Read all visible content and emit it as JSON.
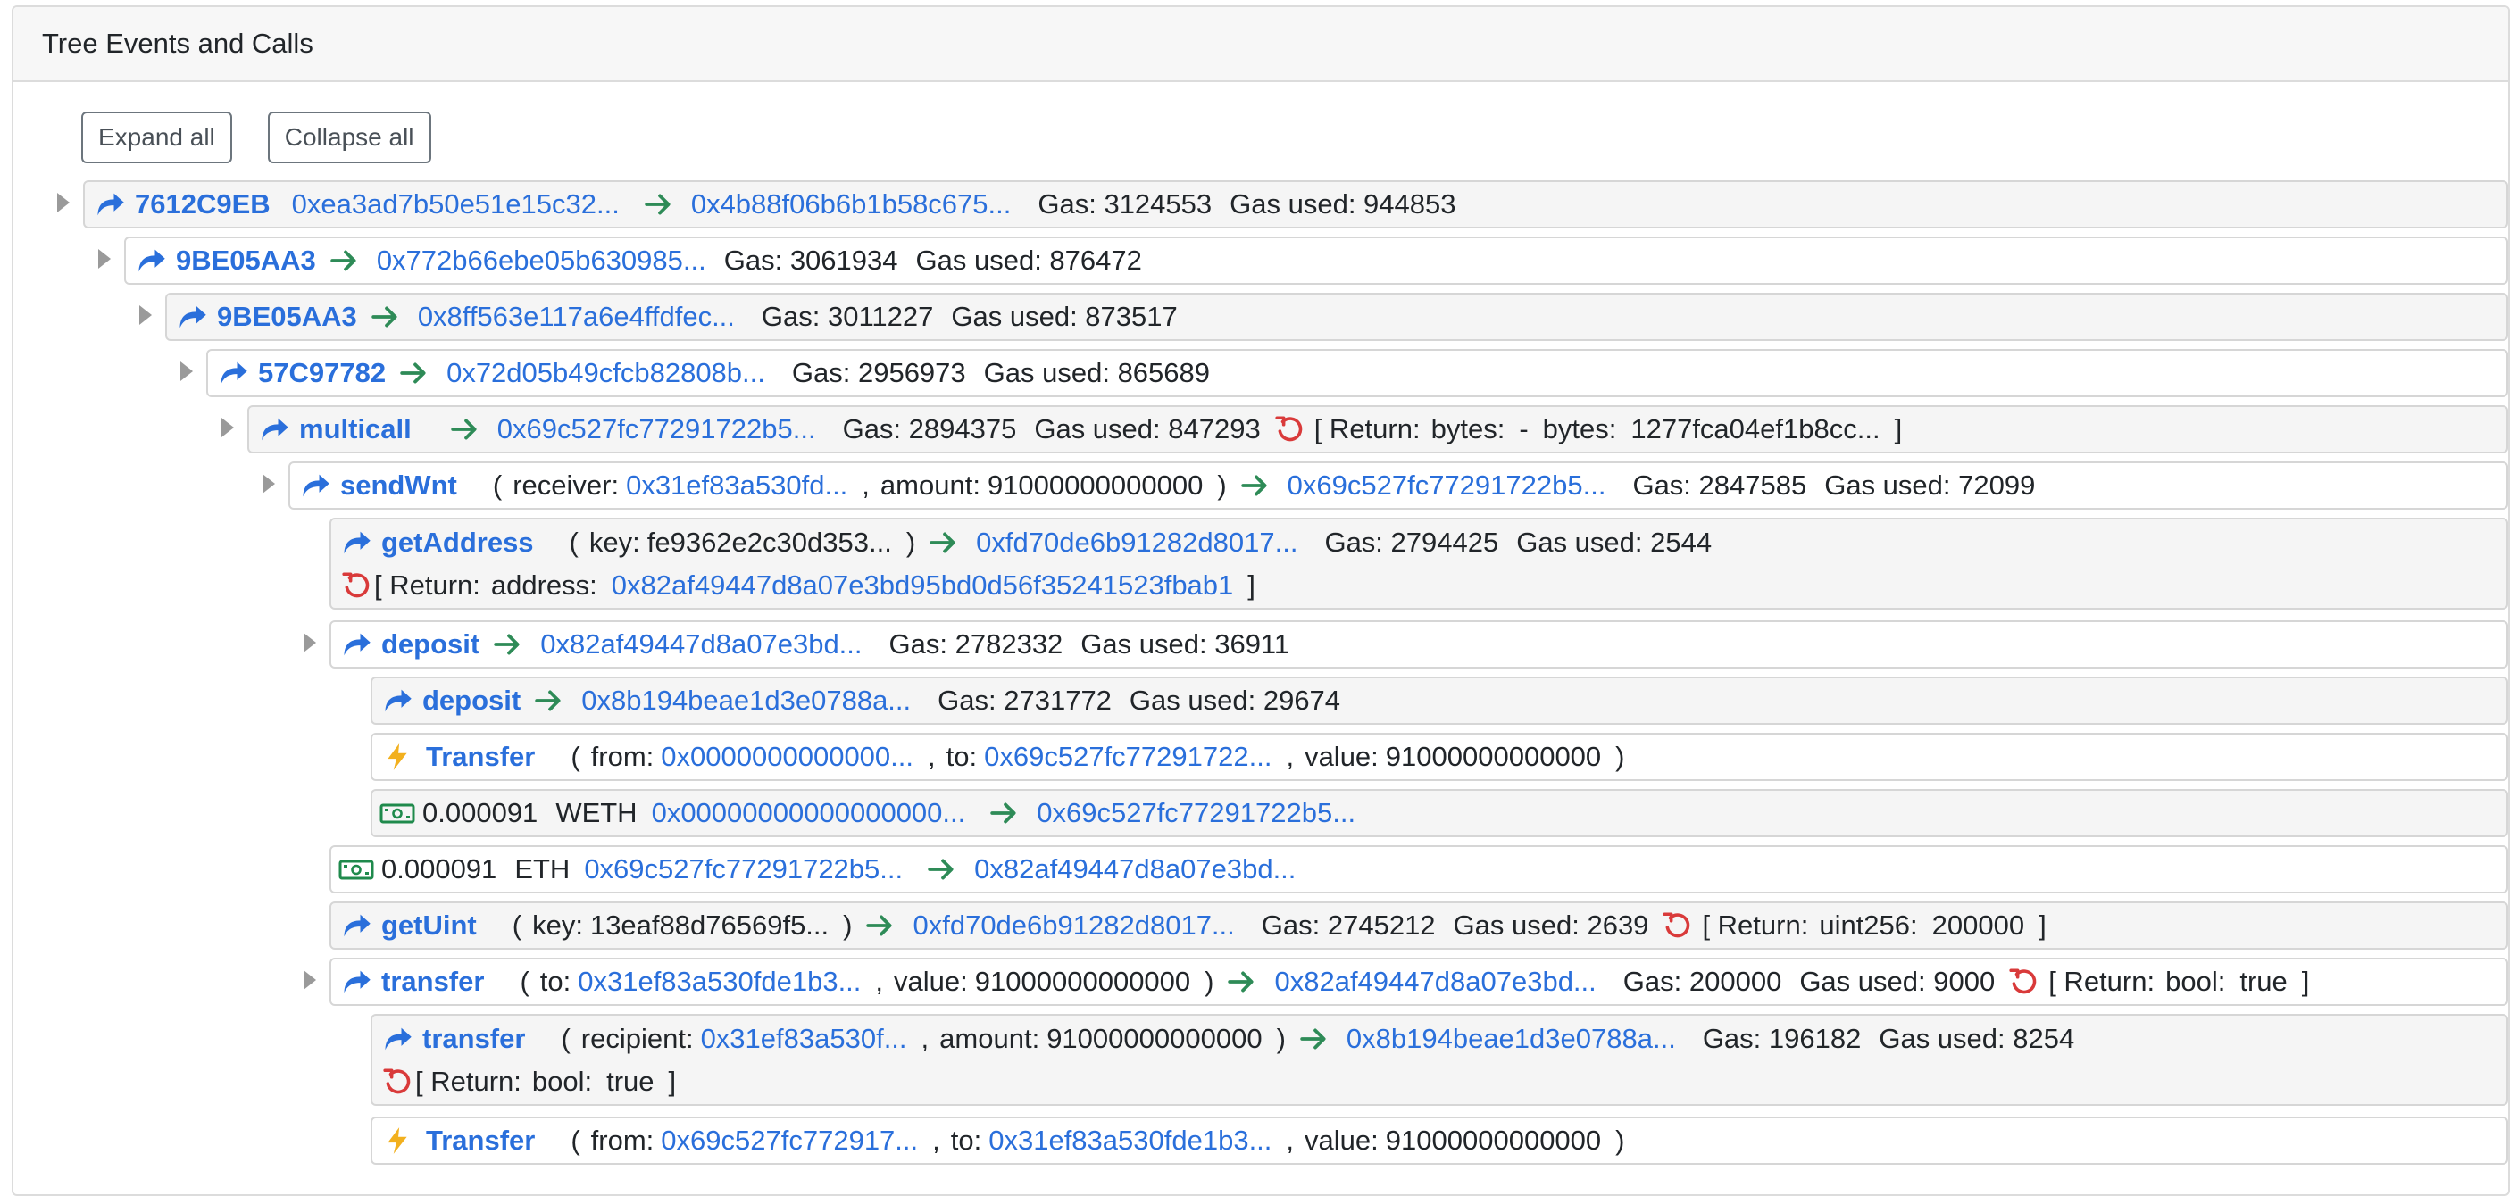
{
  "header": {
    "title": "Tree Events and Calls"
  },
  "toolbar": {
    "expand_label": "Expand all",
    "collapse_label": "Collapse all"
  },
  "tree": {
    "r1": {
      "fn": "7612C9EB",
      "from": "0xea3ad7b50e51e15c32...",
      "to": "0x4b88f06b6b1b58c675...",
      "gas": "Gas: 3124553",
      "gas_used": "Gas used: 944853"
    },
    "r2": {
      "fn": "9BE05AA3",
      "to": "0x772b66ebe05b630985...",
      "gas": "Gas: 3061934",
      "gas_used": "Gas used: 876472"
    },
    "r3": {
      "fn": "9BE05AA3",
      "to": "0x8ff563e117a6e4ffdfec...",
      "gas": "Gas: 3011227",
      "gas_used": "Gas used: 873517"
    },
    "r4": {
      "fn": "57C97782",
      "to": "0x72d05b49cfcb82808b...",
      "gas": "Gas: 2956973",
      "gas_used": "Gas used: 865689"
    },
    "r5": {
      "fn": "multicall",
      "to": "0x69c527fc77291722b5...",
      "gas": "Gas: 2894375",
      "gas_used": "Gas used: 847293",
      "return_open": "[ Return:",
      "ret_type1": "bytes:",
      "ret_val1": "-",
      "ret_type2": "bytes:",
      "ret_val2": "1277fca04ef1b8cc...",
      "return_close": "]"
    },
    "r6": {
      "fn": "sendWnt",
      "paren_open": "(",
      "k1": "receiver:",
      "v1": "0x31ef83a530fd...",
      "comma": ",",
      "k2": "amount:",
      "v2": "91000000000000",
      "paren_close": ")",
      "to": "0x69c527fc77291722b5...",
      "gas": "Gas: 2847585",
      "gas_used": "Gas used: 72099"
    },
    "r7": {
      "fn": "getAddress",
      "paren_open": "(",
      "k1": "key:",
      "v1": "fe9362e2c30d353...",
      "paren_close": ")",
      "to": "0xfd70de6b91282d8017...",
      "gas": "Gas: 2794425",
      "gas_used": "Gas used: 2544",
      "return_open": "[ Return:",
      "ret_type": "address:",
      "ret_val": "0x82af49447d8a07e3bd95bd0d56f35241523fbab1",
      "return_close": "]"
    },
    "r8": {
      "fn": "deposit",
      "to": "0x82af49447d8a07e3bd...",
      "gas": "Gas: 2782332",
      "gas_used": "Gas used: 36911"
    },
    "r9": {
      "fn": "deposit",
      "to": "0x8b194beae1d3e0788a...",
      "gas": "Gas: 2731772",
      "gas_used": "Gas used: 29674"
    },
    "r10": {
      "event": "Transfer",
      "paren_open": "(",
      "k1": "from:",
      "v1": "0x0000000000000...",
      "comma": ",",
      "k2": "to:",
      "v2": "0x69c527fc77291722...",
      "k3": "value:",
      "v3": "91000000000000",
      "paren_close": ")"
    },
    "r11": {
      "amount": "0.000091",
      "token": "WETH",
      "from": "0x00000000000000000...",
      "to": "0x69c527fc77291722b5..."
    },
    "r12": {
      "amount": "0.000091",
      "token": "ETH",
      "from": "0x69c527fc77291722b5...",
      "to": "0x82af49447d8a07e3bd..."
    },
    "r13": {
      "fn": "getUint",
      "paren_open": "(",
      "k1": "key:",
      "v1": "13eaf88d76569f5...",
      "paren_close": ")",
      "to": "0xfd70de6b91282d8017...",
      "gas": "Gas: 2745212",
      "gas_used": "Gas used: 2639",
      "return_open": "[ Return:",
      "ret_type": "uint256:",
      "ret_val": "200000",
      "return_close": "]"
    },
    "r14": {
      "fn": "transfer",
      "paren_open": "(",
      "k1": "to:",
      "v1": "0x31ef83a530fde1b3...",
      "comma": ",",
      "k2": "value:",
      "v2": "91000000000000",
      "paren_close": ")",
      "to": "0x82af49447d8a07e3bd...",
      "gas": "Gas: 200000",
      "gas_used": "Gas used: 9000",
      "return_open": "[ Return:",
      "ret_type": "bool:",
      "ret_val": "true",
      "return_close": "]"
    },
    "r15": {
      "fn": "transfer",
      "paren_open": "(",
      "k1": "recipient:",
      "v1": "0x31ef83a530f...",
      "comma": ",",
      "k2": "amount:",
      "v2": "91000000000000",
      "paren_close": ")",
      "to": "0x8b194beae1d3e0788a...",
      "gas": "Gas: 196182",
      "gas_used": "Gas used: 8254",
      "return_open": "[ Return:",
      "ret_type": "bool:",
      "ret_val": "true",
      "return_close": "]"
    },
    "r16": {
      "event": "Transfer",
      "paren_open": "(",
      "k1": "from:",
      "v1": "0x69c527fc772917...",
      "comma": ",",
      "k2": "to:",
      "v2": "0x31ef83a530fde1b3...",
      "k3": "value:",
      "v3": "91000000000000",
      "paren_close": ")"
    }
  },
  "icons": {
    "call": "call-icon",
    "arrow": "arrow-right-icon",
    "ret": "return-icon",
    "event": "lightning-icon",
    "money": "money-icon",
    "toggle": "caret-right-icon"
  },
  "colors": {
    "link": "#2a6fdb",
    "arrow": "#2e8b57",
    "return": "#d93a3a",
    "event": "#f2b01e",
    "money": "#1f8a4c"
  }
}
